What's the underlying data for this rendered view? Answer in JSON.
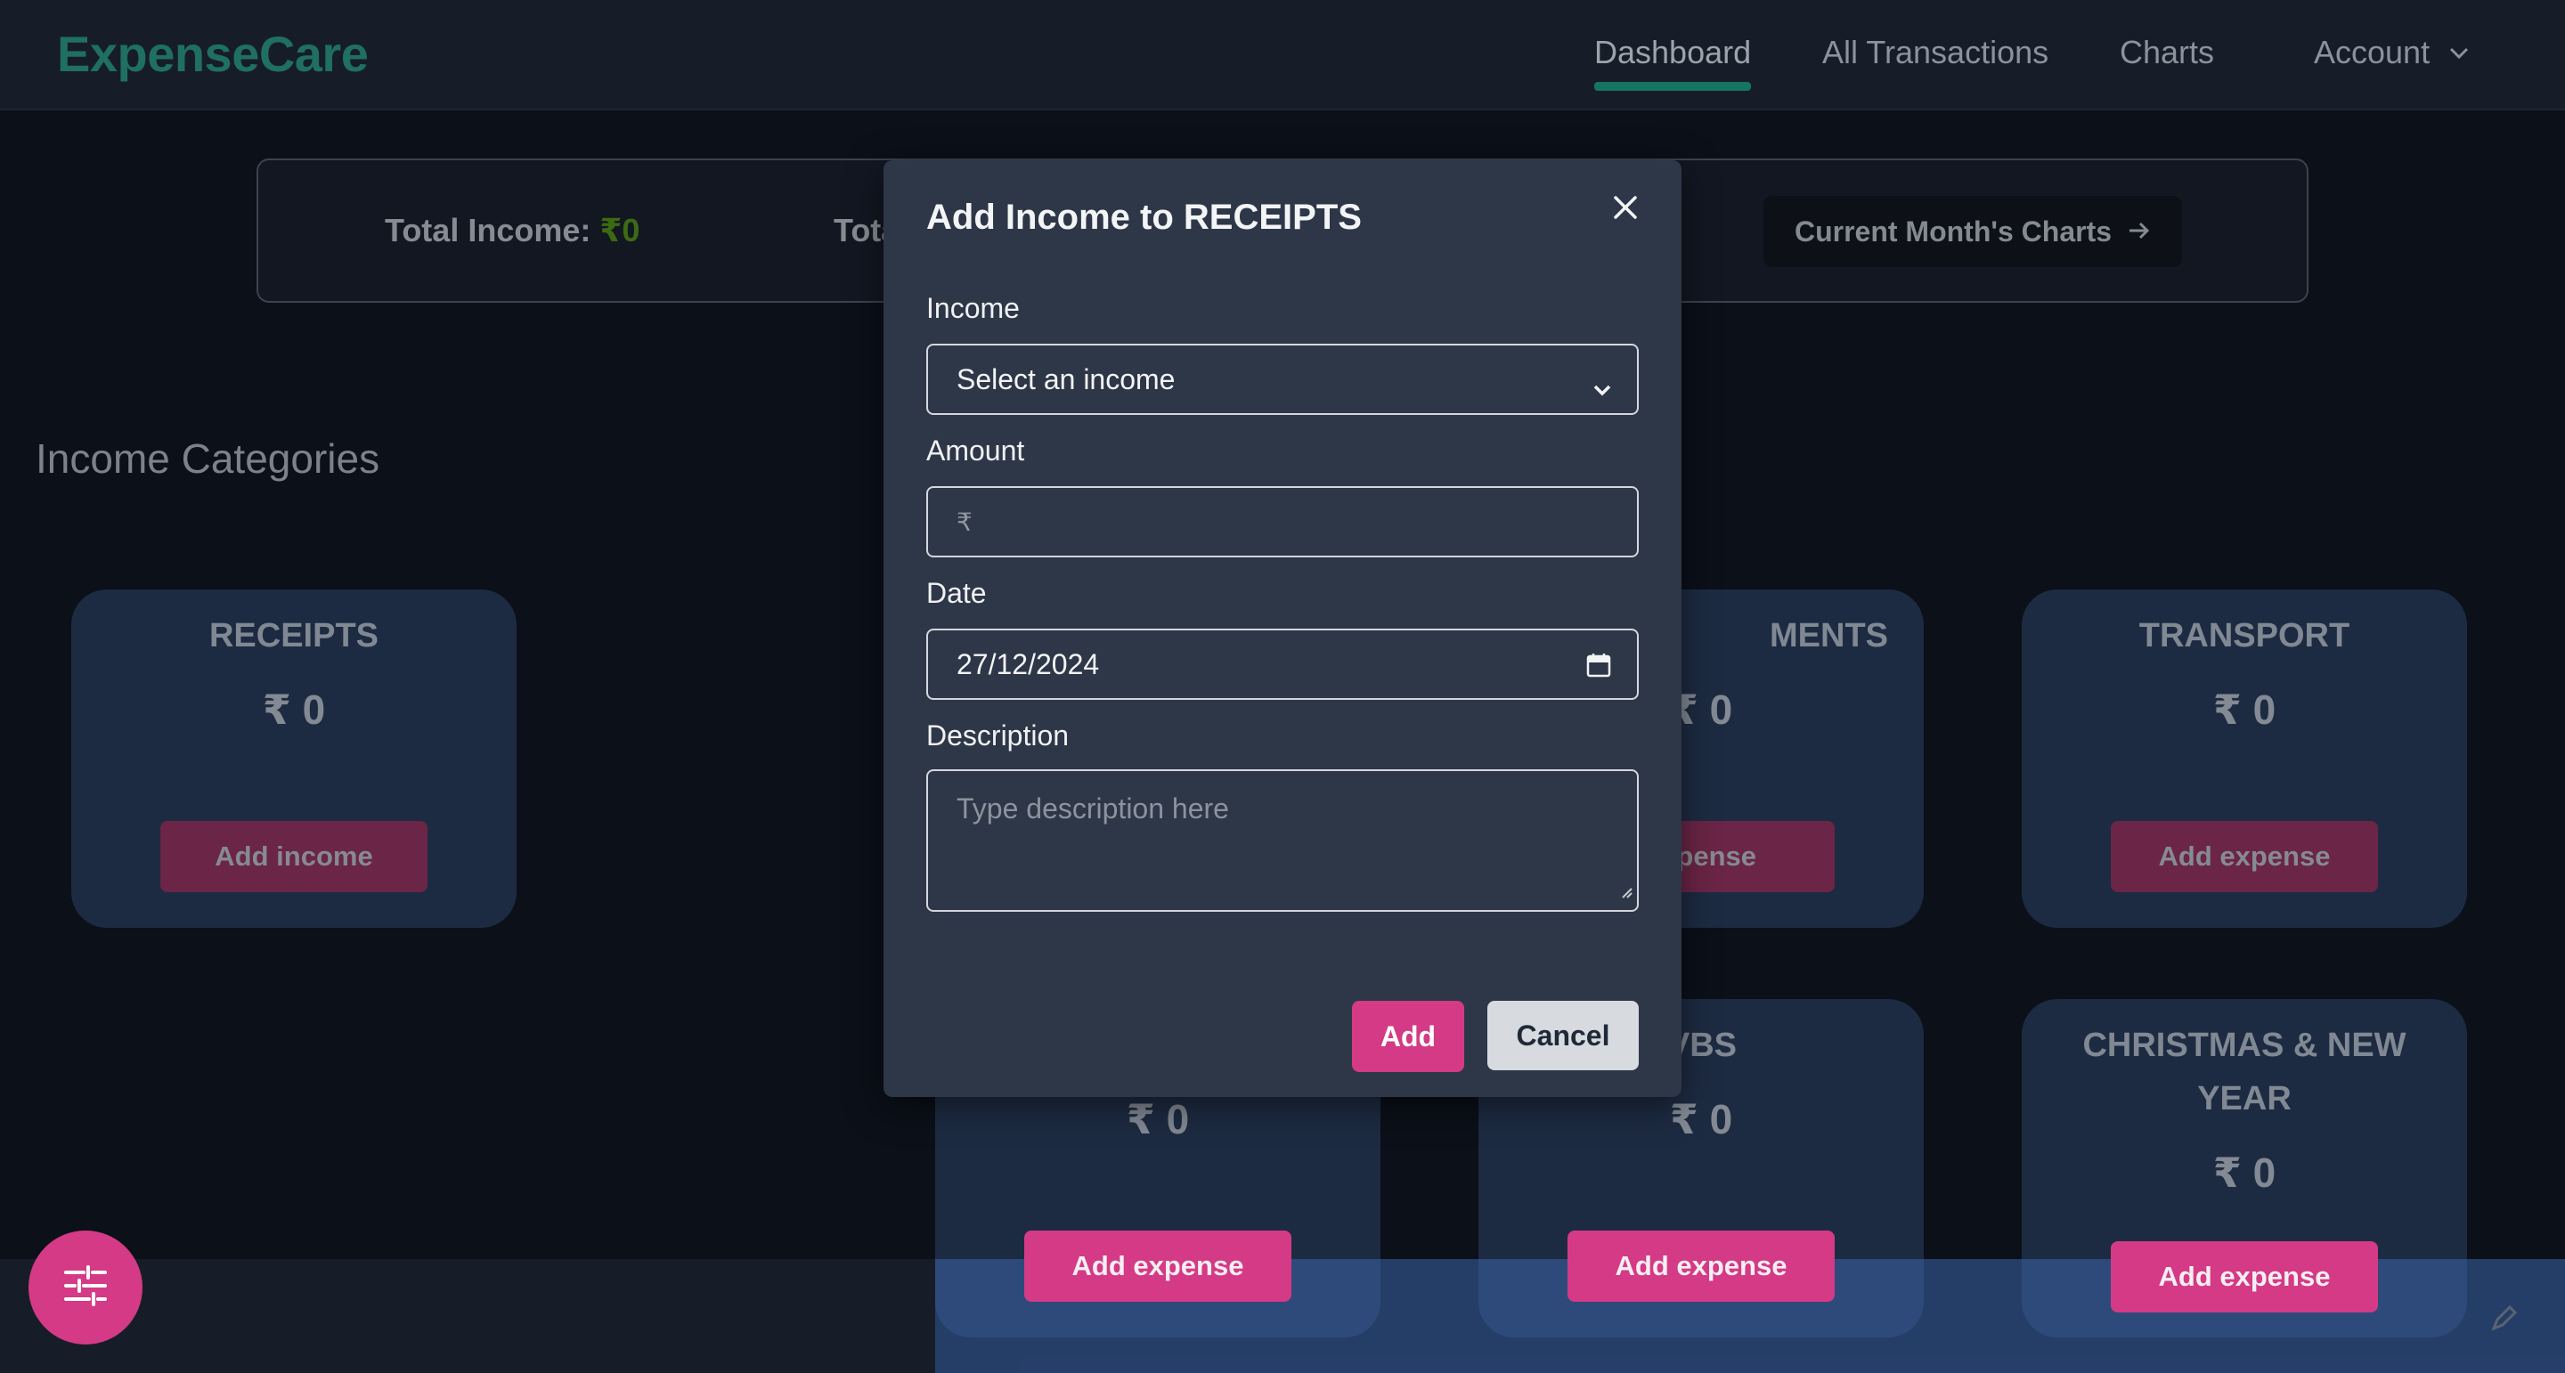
{
  "nav": {
    "brand": "ExpenseCare",
    "links": [
      "Dashboard",
      "All Transactions",
      "Charts",
      "Account"
    ],
    "active": "Dashboard"
  },
  "summary": {
    "income_label": "Total Income:",
    "income_value": "₹0",
    "expense_label_partial": "Tota",
    "charts_button": "Current Month's Charts"
  },
  "section": {
    "income_categories": "Income Categories"
  },
  "cards": {
    "receipts": {
      "title": "RECEIPTS",
      "amount": "₹ 0",
      "button": "Add income"
    },
    "ments": {
      "title": "MENTS",
      "amount": "₹ 0",
      "button": "expense"
    },
    "transport": {
      "title": "TRANSPORT",
      "amount": "₹ 0",
      "button": "Add expense"
    },
    "bottom_a": {
      "amount": "₹ 0",
      "button": "Add expense"
    },
    "vbs": {
      "title": "VBS",
      "amount": "₹ 0",
      "button": "Add expense"
    },
    "christmas": {
      "title": "CHRISTMAS & NEW YEAR",
      "amount": "₹ 0",
      "button": "Add expense"
    }
  },
  "modal": {
    "title": "Add Income to RECEIPTS",
    "income_label": "Income",
    "income_select_value": "Select an income",
    "amount_label": "Amount",
    "amount_prefix": "₹",
    "date_label": "Date",
    "date_value": "27/12/2024",
    "description_label": "Description",
    "description_placeholder": "Type description here",
    "add_button": "Add",
    "cancel_button": "Cancel"
  },
  "colors": {
    "brand": "#1f6f63",
    "accent_pink": "#d43a85",
    "income_green": "#3c6a12",
    "modal_bg": "#2e3748"
  }
}
